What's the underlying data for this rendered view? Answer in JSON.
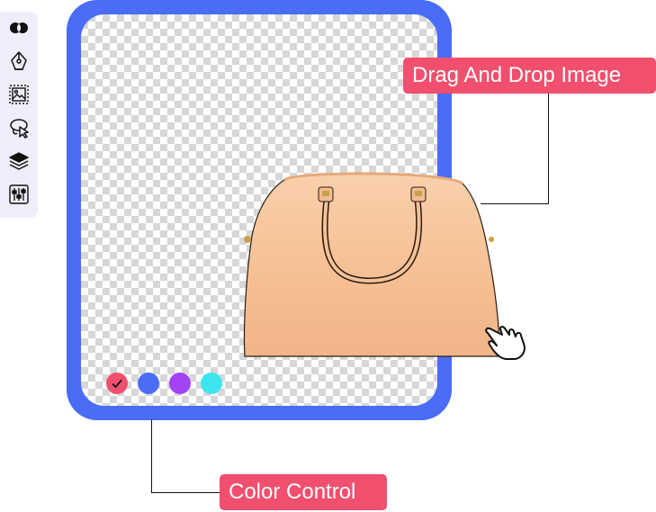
{
  "toolbar": {
    "tools": [
      {
        "icon": "blend-circles-icon"
      },
      {
        "icon": "pen-tool-icon"
      },
      {
        "icon": "image-frame-icon"
      },
      {
        "icon": "lasso-select-icon"
      },
      {
        "icon": "layers-icon"
      },
      {
        "icon": "adjust-sliders-icon"
      }
    ]
  },
  "colors": {
    "frame": "#4a6cf7",
    "label_bg": "#f0506e",
    "bag": "#f7c49a"
  },
  "color_control": {
    "swatches": [
      {
        "color": "#f0506e",
        "selected": true
      },
      {
        "color": "#4a6cf7",
        "selected": false
      },
      {
        "color": "#a243f5",
        "selected": false
      },
      {
        "color": "#3ce6f0",
        "selected": false
      }
    ]
  },
  "callouts": {
    "drag_drop": "Drag And Drop Image",
    "color_control": "Color Control"
  }
}
